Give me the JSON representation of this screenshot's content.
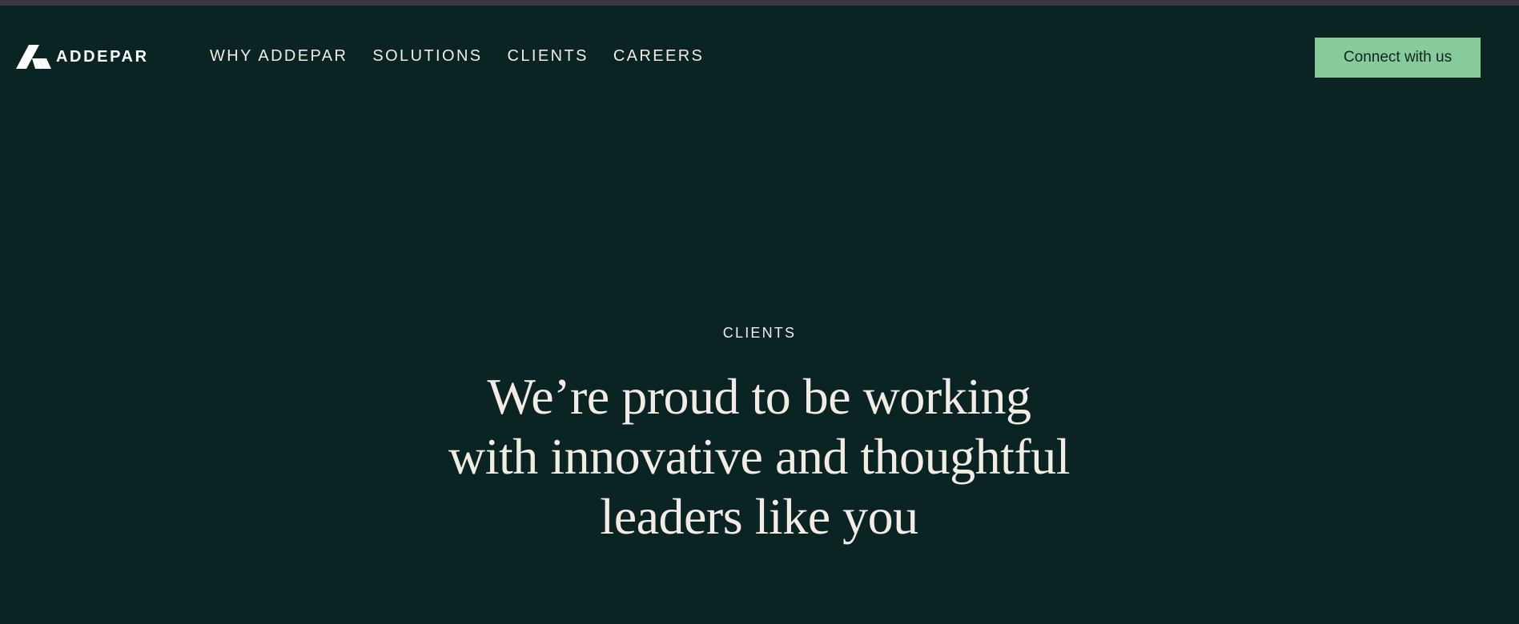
{
  "brand": {
    "name": "ADDEPAR",
    "logo_icon": "addepar-logo-mark"
  },
  "nav": {
    "items": [
      {
        "label": "WHY ADDEPAR"
      },
      {
        "label": "SOLUTIONS"
      },
      {
        "label": "CLIENTS"
      },
      {
        "label": "CAREERS"
      }
    ],
    "cta_label": "Connect with us"
  },
  "hero": {
    "eyebrow": "CLIENTS",
    "headline": "We’re proud to be working with innovative and thoughtful leaders like you"
  },
  "colors": {
    "background": "#0a2323",
    "text": "#f3ece4",
    "accent": "#86cb99",
    "top_strip": "#3a3a3c"
  }
}
